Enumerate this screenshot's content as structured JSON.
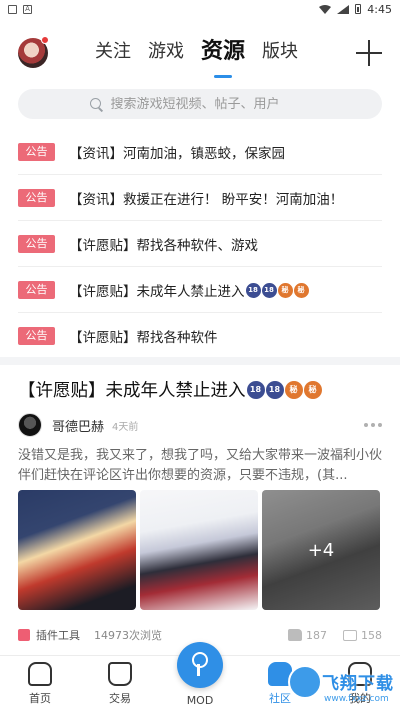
{
  "status_bar": {
    "time": "4:45"
  },
  "top_tabs": [
    {
      "label": "关注",
      "active": false
    },
    {
      "label": "游戏",
      "active": false
    },
    {
      "label": "资源",
      "active": true
    },
    {
      "label": "版块",
      "active": false
    }
  ],
  "search": {
    "placeholder": "搜索游戏短视频、帖子、用户"
  },
  "notices": [
    {
      "badge": "公告",
      "text": "【资讯】河南加油，镇恶蛟，保家园",
      "r18": []
    },
    {
      "badge": "公告",
      "text": "【资讯】救援正在进行！ 盼平安！河南加油！",
      "r18": []
    },
    {
      "badge": "公告",
      "text": "【许愿贴】帮找各种软件、游戏",
      "r18": []
    },
    {
      "badge": "公告",
      "text": "【许愿贴】未成年人禁止进入",
      "r18": [
        "18",
        "18",
        "秘",
        "秘"
      ]
    },
    {
      "badge": "公告",
      "text": "【许愿贴】帮找各种软件",
      "r18": []
    }
  ],
  "post": {
    "title": "【许愿贴】未成年人禁止进入",
    "title_badges": [
      "18",
      "18",
      "秘",
      "秘"
    ],
    "author": "哥德巴赫",
    "time": "4天前",
    "body": "没错又是我，我又来了，想我了吗，又给大家带来一波福利小伙伴们赶快在评论区许出你想要的资源，只要不违规，(其...",
    "more_images": "+4",
    "tag": "插件工具",
    "views": "14973次浏览",
    "likes": "187",
    "comments": "158"
  },
  "bottom_nav": {
    "home": "首页",
    "trade": "交易",
    "mod": "MOD",
    "community": "社区",
    "me": "我的"
  },
  "watermark": {
    "main": "飞翔下载",
    "sub": "www.fxxz.com"
  },
  "colors": {
    "accent": "#2f8fe6",
    "badge": "#ec6a78"
  }
}
